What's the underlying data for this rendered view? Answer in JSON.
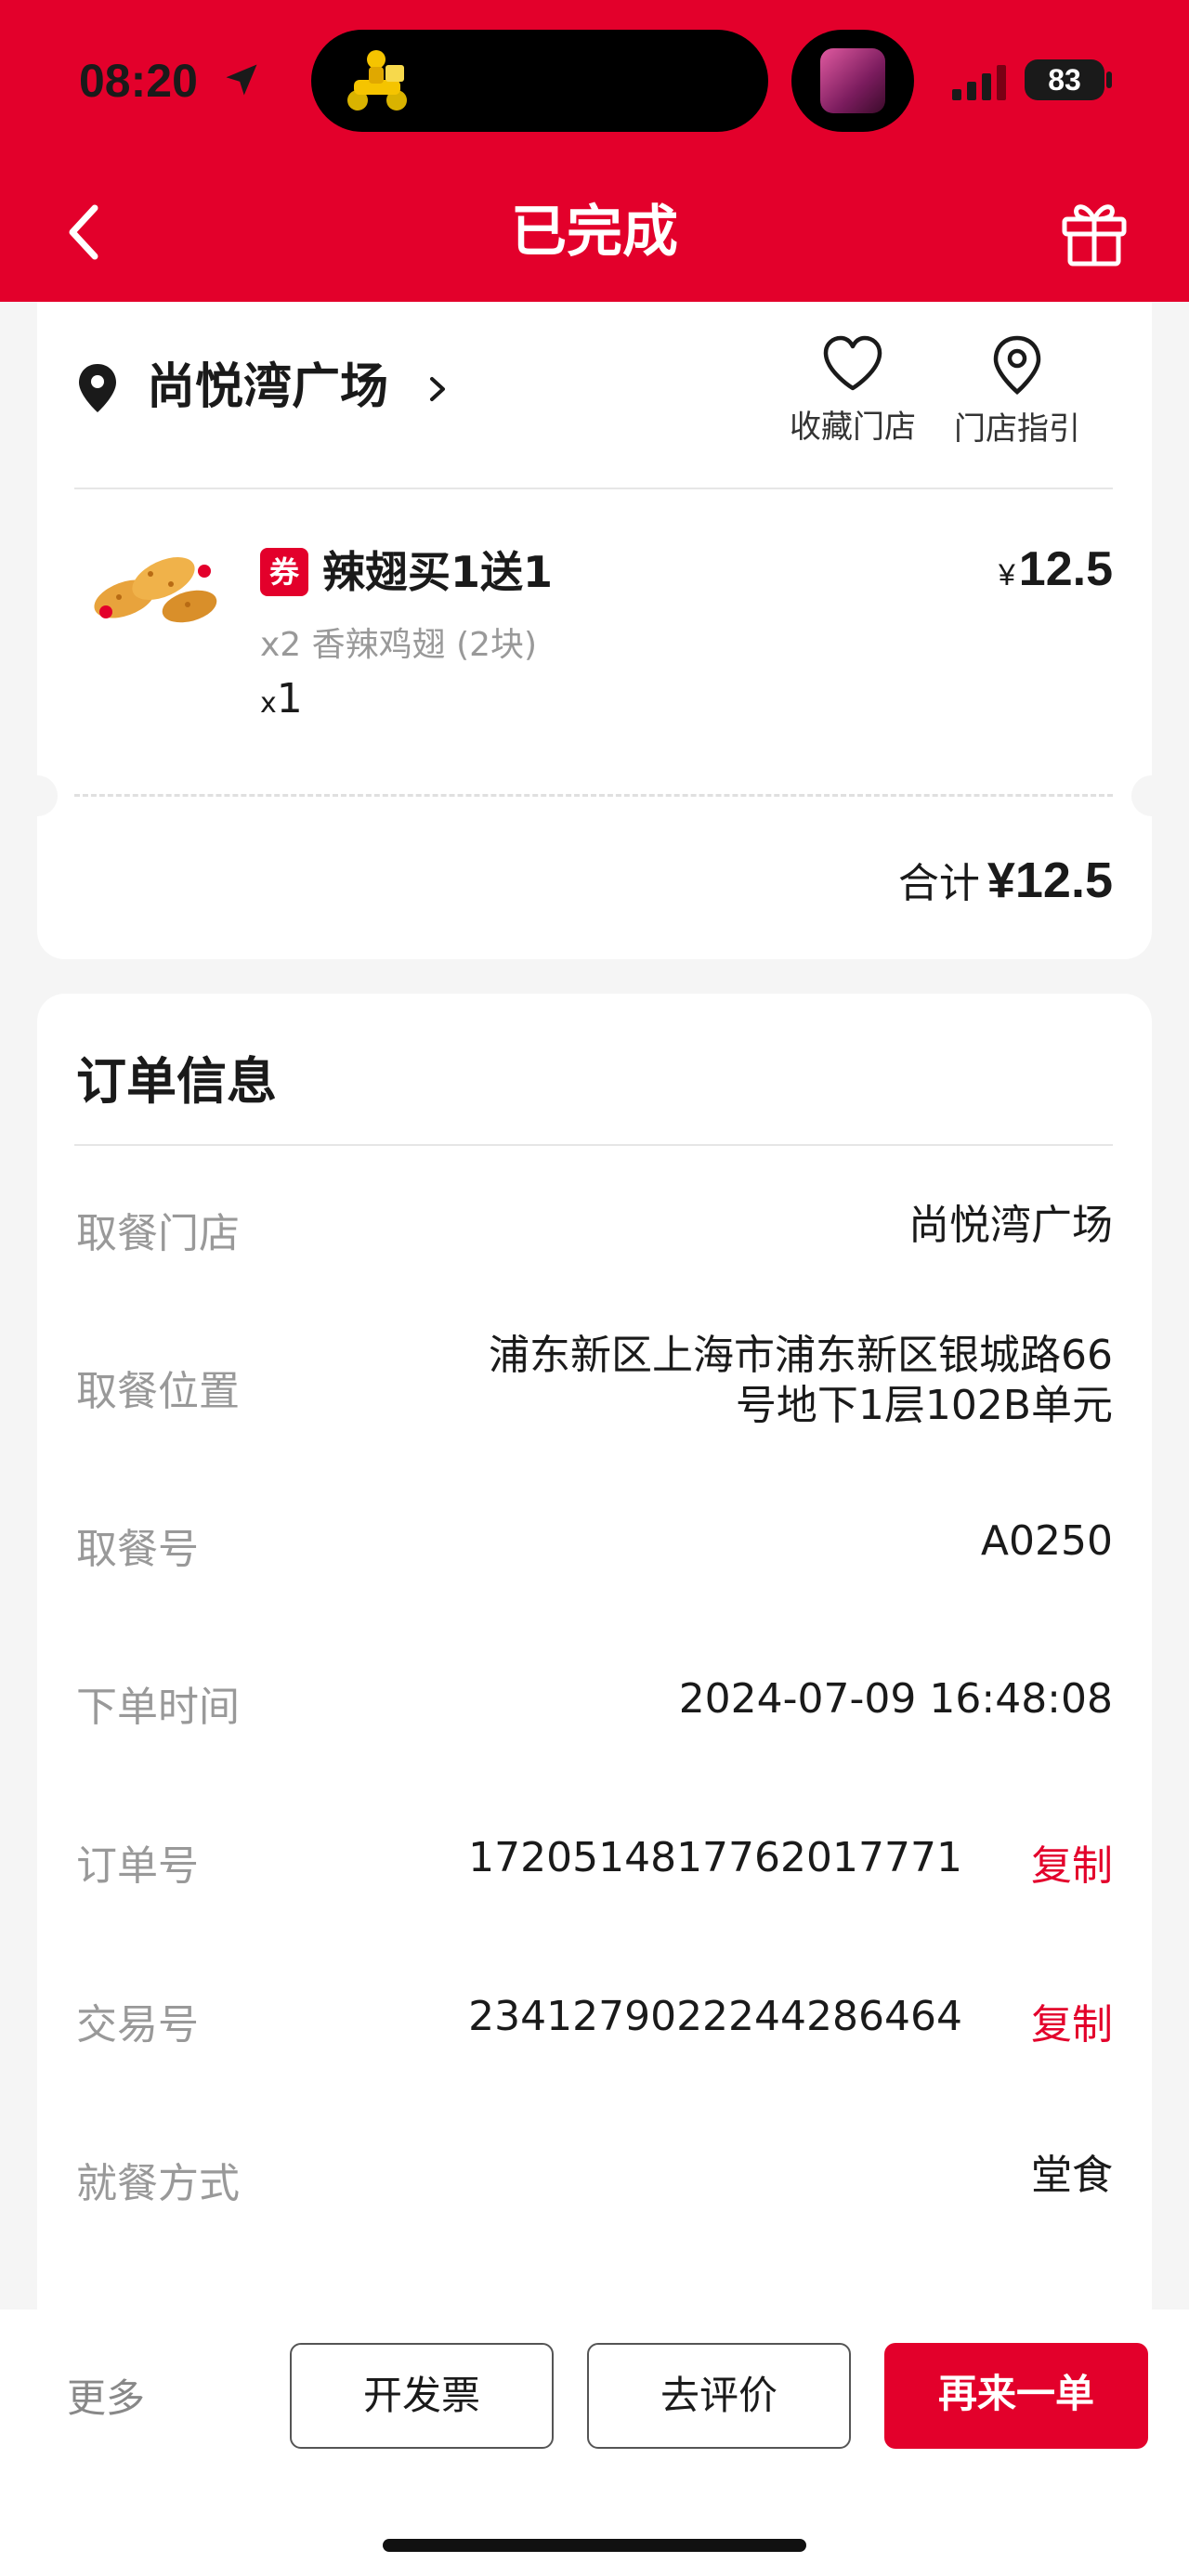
{
  "status_bar": {
    "time": "08:20",
    "battery": "83",
    "app_icon": "delivery-rider-icon"
  },
  "nav": {
    "title": "已完成",
    "back_icon": "back-chevron-icon",
    "gift_icon": "gift-icon"
  },
  "store": {
    "name": "尚悦湾广场",
    "favorite_label": "收藏门店",
    "guide_label": "门店指引"
  },
  "item": {
    "badge": "券",
    "name": "辣翅买1送1",
    "currency": "¥",
    "price": "12.5",
    "detail": "x2 香辣鸡翅 (2块)",
    "qty_prefix": "x",
    "qty": "1"
  },
  "summary": {
    "total_label": "合计",
    "total_value": "¥12.5"
  },
  "order_info": {
    "title": "订单信息",
    "rows": [
      {
        "label": "取餐门店",
        "value": "尚悦湾广场"
      },
      {
        "label": "取餐位置",
        "value_line1": "浦东新区上海市浦东新区银城路66",
        "value_line2": "号地下1层102B单元"
      },
      {
        "label": "取餐号",
        "value": "A0250"
      },
      {
        "label": "下单时间",
        "value": "2024-07-09 16:48:08"
      },
      {
        "label": "订单号",
        "value": "1720514817762017771",
        "action": "复制"
      },
      {
        "label": "交易号",
        "value": "2341279022244286464",
        "action": "复制"
      },
      {
        "label": "就餐方式",
        "value": "堂食"
      }
    ]
  },
  "bottom_bar": {
    "more": "更多",
    "invoice": "开发票",
    "review": "去评价",
    "reorder": "再来一单"
  },
  "colors": {
    "brand_red": "#e3002b",
    "background": "#f5f5f5"
  }
}
